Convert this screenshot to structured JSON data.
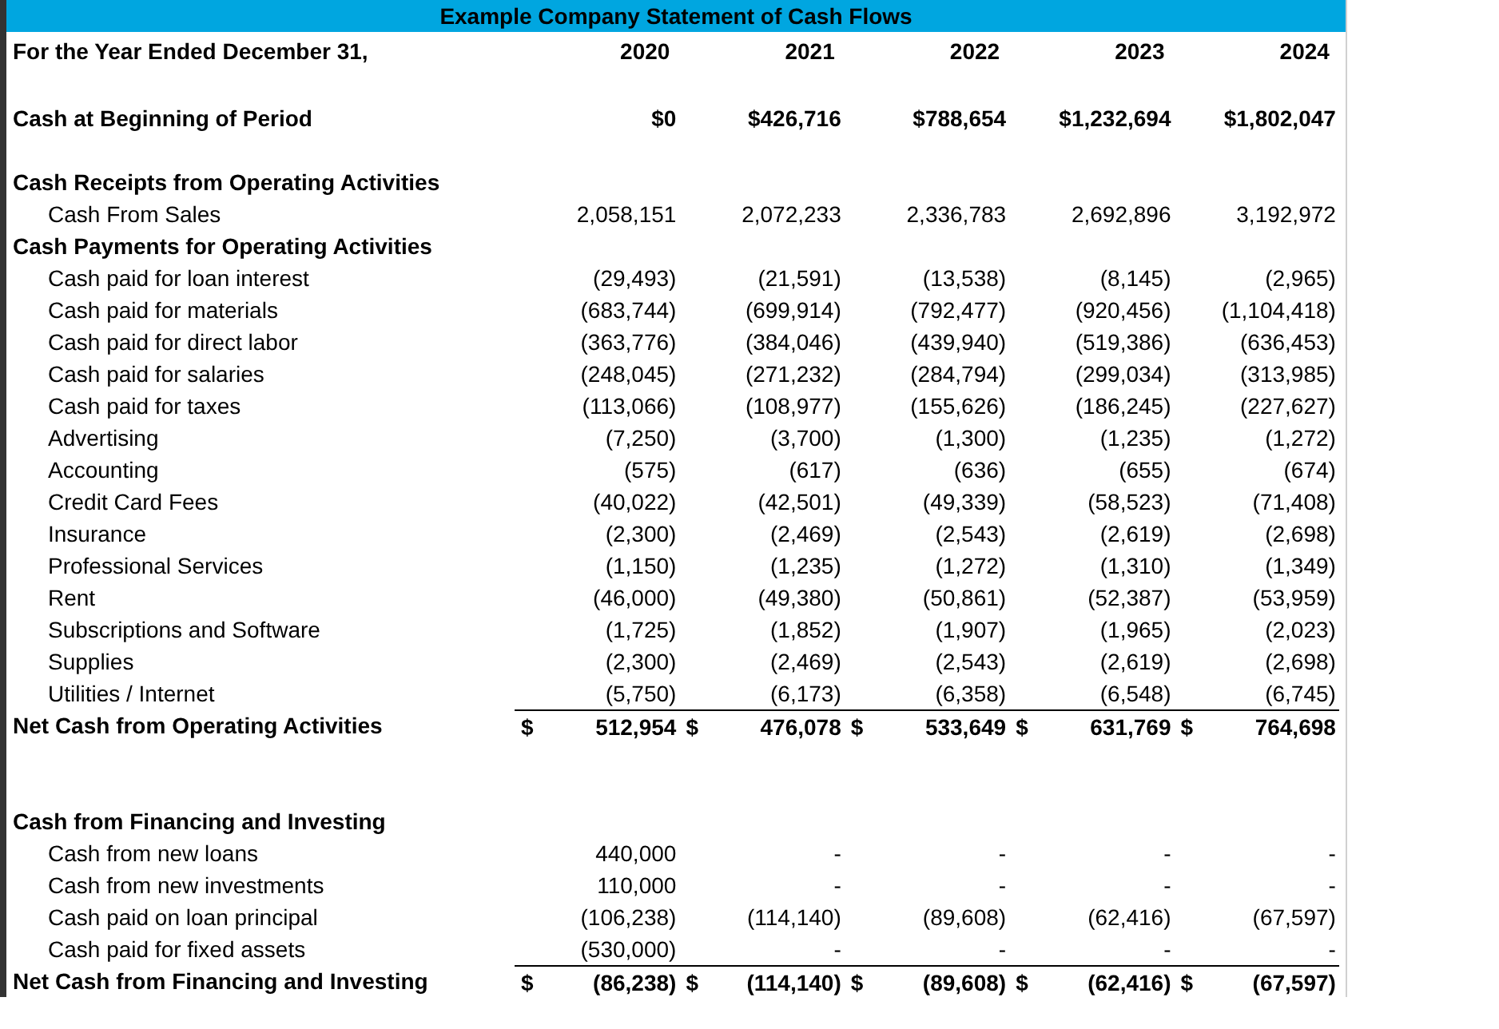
{
  "title": "Example Company Statement of Cash Flows",
  "rows": [
    {
      "kind": "header",
      "label": "For the Year Ended December 31,",
      "values": [
        "2020",
        "2021",
        "2022",
        "2023",
        "2024"
      ]
    },
    {
      "kind": "spacer"
    },
    {
      "kind": "bold",
      "label": "Cash at Beginning of Period",
      "values": [
        "$0",
        "$426,716",
        "$788,654",
        "$1,232,694",
        "$1,802,047"
      ]
    },
    {
      "kind": "spacer"
    },
    {
      "kind": "section",
      "label": "Cash Receipts from Operating Activities"
    },
    {
      "kind": "item",
      "label": "Cash From Sales",
      "values": [
        "2,058,151",
        "2,072,233",
        "2,336,783",
        "2,692,896",
        "3,192,972"
      ]
    },
    {
      "kind": "section",
      "label": "Cash Payments for Operating Activities"
    },
    {
      "kind": "item",
      "label": "Cash paid for loan interest",
      "values": [
        "(29,493)",
        "(21,591)",
        "(13,538)",
        "(8,145)",
        "(2,965)"
      ]
    },
    {
      "kind": "item",
      "label": "Cash paid for materials",
      "values": [
        "(683,744)",
        "(699,914)",
        "(792,477)",
        "(920,456)",
        "(1,104,418)"
      ]
    },
    {
      "kind": "item",
      "label": "Cash paid for direct labor",
      "values": [
        "(363,776)",
        "(384,046)",
        "(439,940)",
        "(519,386)",
        "(636,453)"
      ]
    },
    {
      "kind": "item",
      "label": "Cash paid for salaries",
      "values": [
        "(248,045)",
        "(271,232)",
        "(284,794)",
        "(299,034)",
        "(313,985)"
      ]
    },
    {
      "kind": "item",
      "label": "Cash paid for taxes",
      "values": [
        "(113,066)",
        "(108,977)",
        "(155,626)",
        "(186,245)",
        "(227,627)"
      ]
    },
    {
      "kind": "item",
      "label": "Advertising",
      "values": [
        "(7,250)",
        "(3,700)",
        "(1,300)",
        "(1,235)",
        "(1,272)"
      ]
    },
    {
      "kind": "item",
      "label": "Accounting",
      "values": [
        "(575)",
        "(617)",
        "(636)",
        "(655)",
        "(674)"
      ]
    },
    {
      "kind": "item",
      "label": "Credit Card Fees",
      "values": [
        "(40,022)",
        "(42,501)",
        "(49,339)",
        "(58,523)",
        "(71,408)"
      ]
    },
    {
      "kind": "item",
      "label": "Insurance",
      "values": [
        "(2,300)",
        "(2,469)",
        "(2,543)",
        "(2,619)",
        "(2,698)"
      ]
    },
    {
      "kind": "item",
      "label": "Professional Services",
      "values": [
        "(1,150)",
        "(1,235)",
        "(1,272)",
        "(1,310)",
        "(1,349)"
      ]
    },
    {
      "kind": "item",
      "label": "Rent",
      "values": [
        "(46,000)",
        "(49,380)",
        "(50,861)",
        "(52,387)",
        "(53,959)"
      ]
    },
    {
      "kind": "item",
      "label": "Subscriptions and Software",
      "values": [
        "(1,725)",
        "(1,852)",
        "(1,907)",
        "(1,965)",
        "(2,023)"
      ]
    },
    {
      "kind": "item",
      "label": "Supplies",
      "values": [
        "(2,300)",
        "(2,469)",
        "(2,543)",
        "(2,619)",
        "(2,698)"
      ]
    },
    {
      "kind": "item",
      "label": "Utilities / Internet",
      "values": [
        "(5,750)",
        "(6,173)",
        "(6,358)",
        "(6,548)",
        "(6,745)"
      ]
    },
    {
      "kind": "total",
      "label": "Net Cash from Operating Activities",
      "symbols": [
        "$",
        "$",
        "$",
        "$",
        "$"
      ],
      "values": [
        "512,954",
        "476,078",
        "533,649",
        "631,769",
        "764,698"
      ]
    },
    {
      "kind": "spacer"
    },
    {
      "kind": "spacer"
    },
    {
      "kind": "section",
      "label": "Cash from Financing and Investing"
    },
    {
      "kind": "item",
      "label": "Cash from new loans",
      "values": [
        "440,000",
        "-",
        "-",
        "-",
        "-"
      ]
    },
    {
      "kind": "item",
      "label": "Cash from new investments",
      "values": [
        "110,000",
        "-",
        "-",
        "-",
        "-"
      ]
    },
    {
      "kind": "item",
      "label": "Cash paid on loan principal",
      "values": [
        "(106,238)",
        "(114,140)",
        "(89,608)",
        "(62,416)",
        "(67,597)"
      ]
    },
    {
      "kind": "item",
      "label": "Cash paid for fixed assets",
      "values": [
        "(530,000)",
        "-",
        "-",
        "-",
        "-"
      ]
    },
    {
      "kind": "total",
      "label": "Net Cash from Financing and Investing",
      "symbols": [
        "$",
        "$",
        "$",
        "$",
        "$"
      ],
      "values": [
        "(86,238)",
        "(114,140)",
        "(89,608)",
        "(62,416)",
        "(67,597)"
      ]
    }
  ]
}
